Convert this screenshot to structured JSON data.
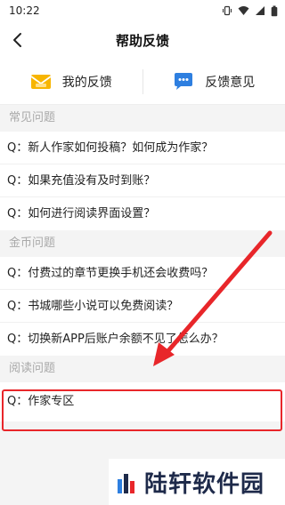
{
  "status_bar": {
    "time": "10:22"
  },
  "header": {
    "title": "帮助反馈"
  },
  "quick_actions": [
    {
      "label": "我的反馈",
      "icon": "envelope-icon"
    },
    {
      "label": "反馈意见",
      "icon": "chat-bubble-icon"
    }
  ],
  "sections": [
    {
      "title": "常见问题",
      "items": [
        "Q：新人作家如何投稿？如何成为作家？",
        "Q：如果充值没有及时到账？",
        "Q：如何进行阅读界面设置？"
      ]
    },
    {
      "title": "金币问题",
      "items": [
        "Q：付费过的章节更换手机还会收费吗？",
        "Q：书城哪些小说可以免费阅读？",
        "Q：切换新APP后账户余额不见了怎么办？"
      ]
    },
    {
      "title": "阅读问题",
      "items": [
        "Q：作家专区"
      ]
    }
  ],
  "watermark": {
    "text": "陆轩软件园"
  },
  "colors": {
    "accent_yellow": "#f7b500",
    "accent_blue": "#2e7fe0",
    "highlight_red": "#e8262a"
  }
}
